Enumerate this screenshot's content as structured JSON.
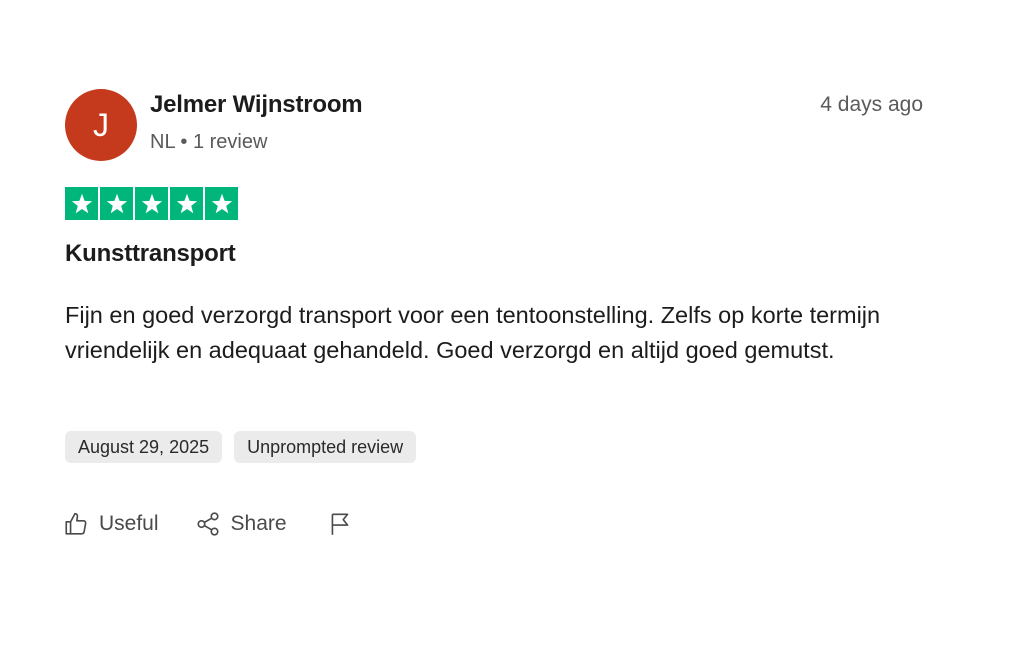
{
  "reviewer": {
    "initial": "J",
    "name": "Jelmer Wijnstroom",
    "meta": "NL • 1 review",
    "avatar_color": "#c53a1c"
  },
  "review": {
    "age": "4 days ago",
    "rating": 5,
    "rating_max": 5,
    "star_color": "#00b67a",
    "title": "Kunsttransport",
    "body": "Fijn en goed verzorgd transport voor een tentoonstelling. Zelfs op korte termijn vriendelijk en adequaat gehandeld. Goed verzorgd en altijd goed gemutst.",
    "tags": {
      "date": "August 29, 2025",
      "type": "Unprompted review"
    }
  },
  "actions": {
    "useful_label": "Useful",
    "useful_icon": "thumbs-up-icon",
    "share_label": "Share",
    "share_icon": "share-icon",
    "report_icon": "flag-icon"
  }
}
